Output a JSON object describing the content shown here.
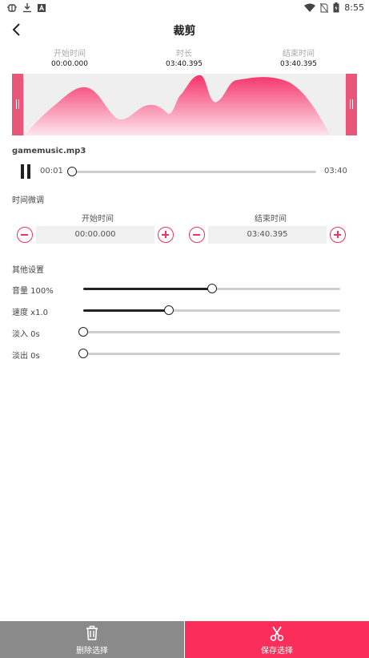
{
  "status_bar": {
    "left_icons": [
      "bug-icon",
      "download-icon",
      "a-badge-icon"
    ],
    "right_icons": [
      "wifi-icon",
      "no-sim-icon",
      "battery-icon"
    ],
    "time": "8:55"
  },
  "header": {
    "title": "裁剪",
    "back_icon": "chevron-left-icon"
  },
  "summary": [
    {
      "label": "开始时间",
      "value": "00:00.000"
    },
    {
      "label": "时长",
      "value": "03:40.395"
    },
    {
      "label": "结束时间",
      "value": "03:40.395"
    }
  ],
  "waveform": {
    "color_top": "#f5336a",
    "color_bottom": "#fde6ec",
    "handle_color": "#e8567a"
  },
  "player": {
    "filename": "gamemusic.mp3",
    "current_time": "00:01",
    "end_time": "03:40",
    "progress": 0.0
  },
  "fine_tune": {
    "section_title": "时间微调",
    "start": {
      "label": "开始时间",
      "value": "00:00.000"
    },
    "end": {
      "label": "结束时间",
      "value": "03:40.395"
    }
  },
  "settings": {
    "section_title": "其他设置",
    "items": [
      {
        "label": "音量 100%",
        "fraction": 0.5
      },
      {
        "label": "速度 x1.0",
        "fraction": 0.333
      },
      {
        "label": "淡入 0s",
        "fraction": 0.0
      },
      {
        "label": "淡出 0s",
        "fraction": 0.0
      }
    ]
  },
  "bottom": {
    "delete_label": "删除选择",
    "save_label": "保存选择",
    "delete_color": "#8a8a8a",
    "save_color": "#fb2d5a"
  }
}
